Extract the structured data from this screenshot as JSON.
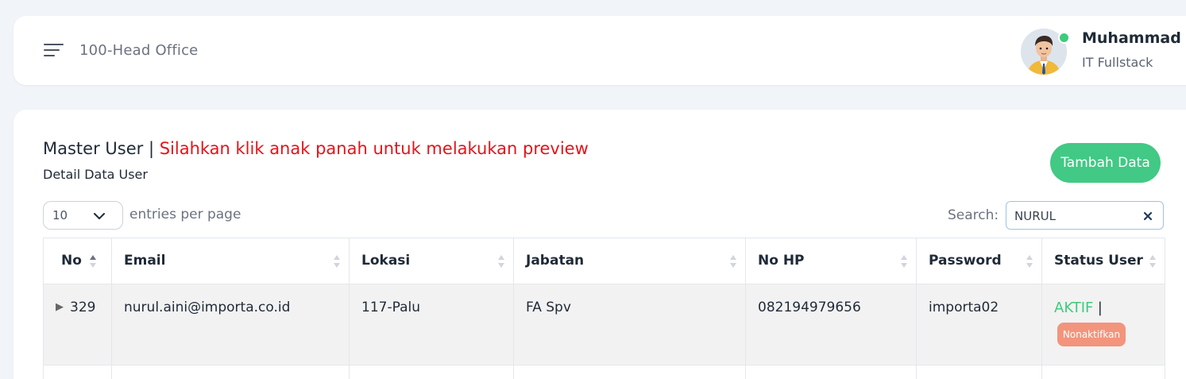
{
  "header": {
    "office": "100-Head Office",
    "user_name": "Muhammad",
    "user_role": "IT Fullstack"
  },
  "page": {
    "title": "Master User",
    "title_separator": " | ",
    "hint": "Silahkan klik anak panah untuk melakukan preview",
    "subtitle": "Detail Data User",
    "add_button": "Tambah Data"
  },
  "controls": {
    "entries_value": "10",
    "entries_label": "entries per page",
    "search_label": "Search:",
    "search_value": "NURUL"
  },
  "table": {
    "columns": [
      "No",
      "Email",
      "Lokasi",
      "Jabatan",
      "No HP",
      "Password",
      "Status User"
    ],
    "rows": [
      {
        "no": "329",
        "email": "nurul.aini@importa.co.id",
        "lokasi": "117-Palu",
        "jabatan": "FA Spv",
        "no_hp": "082194979656",
        "password": "importa02",
        "status": "AKTIF",
        "status_separator": "|",
        "action": "Nonaktifkan"
      }
    ]
  },
  "colors": {
    "accent_green": "#41c985",
    "hint_red": "#e3141a",
    "deactivate_salmon": "#f2957c"
  }
}
